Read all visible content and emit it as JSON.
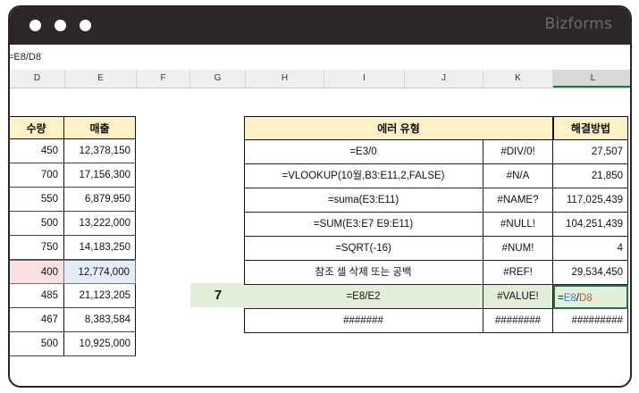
{
  "app": {
    "brand": "Bizforms"
  },
  "formula_bar": {
    "text": "=E8/D8"
  },
  "columns": [
    "D",
    "E",
    "F",
    "G",
    "H",
    "I",
    "J",
    "K",
    "L"
  ],
  "left_table": {
    "headers": {
      "qty": "수량",
      "sales": "매출"
    },
    "rows": [
      {
        "qty": "450",
        "sales": "12,378,150"
      },
      {
        "qty": "700",
        "sales": "17,156,300"
      },
      {
        "qty": "550",
        "sales": "6,879,950"
      },
      {
        "qty": "500",
        "sales": "13,222,000"
      },
      {
        "qty": "750",
        "sales": "14,183,250"
      },
      {
        "qty": "400",
        "sales": "12,774,000"
      },
      {
        "qty": "485",
        "sales": "21,123,205"
      },
      {
        "qty": "467",
        "sales": "8,383,584"
      },
      {
        "qty": "500",
        "sales": "10,925,000"
      }
    ]
  },
  "row_label": "7",
  "right_table": {
    "headers": {
      "error_type": "에러 유형",
      "solution": "해결방법"
    },
    "rows": [
      {
        "formula": "=E3/0",
        "error": "#DIV/0!",
        "result": "27,507"
      },
      {
        "formula": "=VLOOKUP(10월,B3:E11,2,FALSE)",
        "error": "#N/A",
        "result": "21,850"
      },
      {
        "formula": "=suma(E3:E11)",
        "error": "#NAME?",
        "result": "117,025,439"
      },
      {
        "formula": "=SUM(E3:E7 E9:E11)",
        "error": "#NULL!",
        "result": "104,251,439"
      },
      {
        "formula": "=SQRT(-16)",
        "error": "#NUM!",
        "result": "4"
      },
      {
        "formula": "참조 셀 삭제 또는 공백",
        "error": "#REF!",
        "result": "29,534,450"
      },
      {
        "formula": "=E8/E2",
        "error": "#VALUE!",
        "result": ""
      },
      {
        "formula": "#######",
        "error": "########",
        "result": "#########"
      }
    ],
    "active_formula": {
      "eq": "=",
      "ref1": "E8",
      "slash": "/",
      "ref2": "D8"
    }
  },
  "colors": {
    "ref_blue": "#3f7bd4",
    "ref_red": "#c0504d",
    "header_fill": "#fdf1c6",
    "highlight_fill": "#e3f0d9",
    "excel_green": "#217346"
  }
}
